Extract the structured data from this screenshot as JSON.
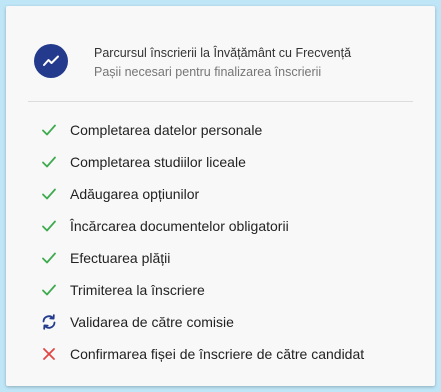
{
  "header": {
    "title": "Parcursul înscrierii la Învățământ cu Frecvență",
    "subtitle": "Pașii necesari pentru finalizarea înscrierii",
    "icon": "trending-up-icon",
    "icon_bg": "#243a8c"
  },
  "colors": {
    "done": "#3faa4f",
    "in_progress": "#243a8c",
    "failed": "#e04646"
  },
  "steps": [
    {
      "label": "Completarea datelor personale",
      "status": "done",
      "icon": "check-icon"
    },
    {
      "label": "Completarea studiilor liceale",
      "status": "done",
      "icon": "check-icon"
    },
    {
      "label": "Adăugarea opțiunilor",
      "status": "done",
      "icon": "check-icon"
    },
    {
      "label": "Încărcarea documentelor obligatorii",
      "status": "done",
      "icon": "check-icon"
    },
    {
      "label": "Efectuarea plății",
      "status": "done",
      "icon": "check-icon"
    },
    {
      "label": "Trimiterea la înscriere",
      "status": "done",
      "icon": "check-icon"
    },
    {
      "label": "Validarea de către comisie",
      "status": "in_progress",
      "icon": "sync-icon"
    },
    {
      "label": "Confirmarea fișei de înscriere de către candidat",
      "status": "failed",
      "icon": "close-icon"
    }
  ]
}
